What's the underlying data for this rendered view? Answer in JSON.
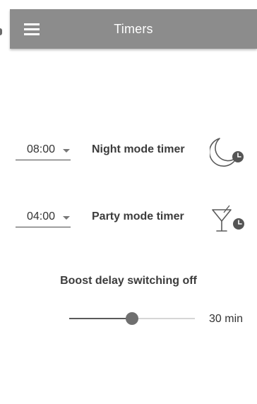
{
  "header": {
    "title": "Timers",
    "menu_icon": "hamburger-menu-icon",
    "background_color": "#8c8c8c"
  },
  "timers": [
    {
      "time": "08:00",
      "label": "Night mode timer",
      "icon": "moon-clock-icon"
    },
    {
      "time": "04:00",
      "label": "Party mode timer",
      "icon": "cocktail-clock-icon"
    }
  ],
  "boost": {
    "label": "Boost delay switching off",
    "value_text": "30 min",
    "slider_fraction": 0.5
  }
}
